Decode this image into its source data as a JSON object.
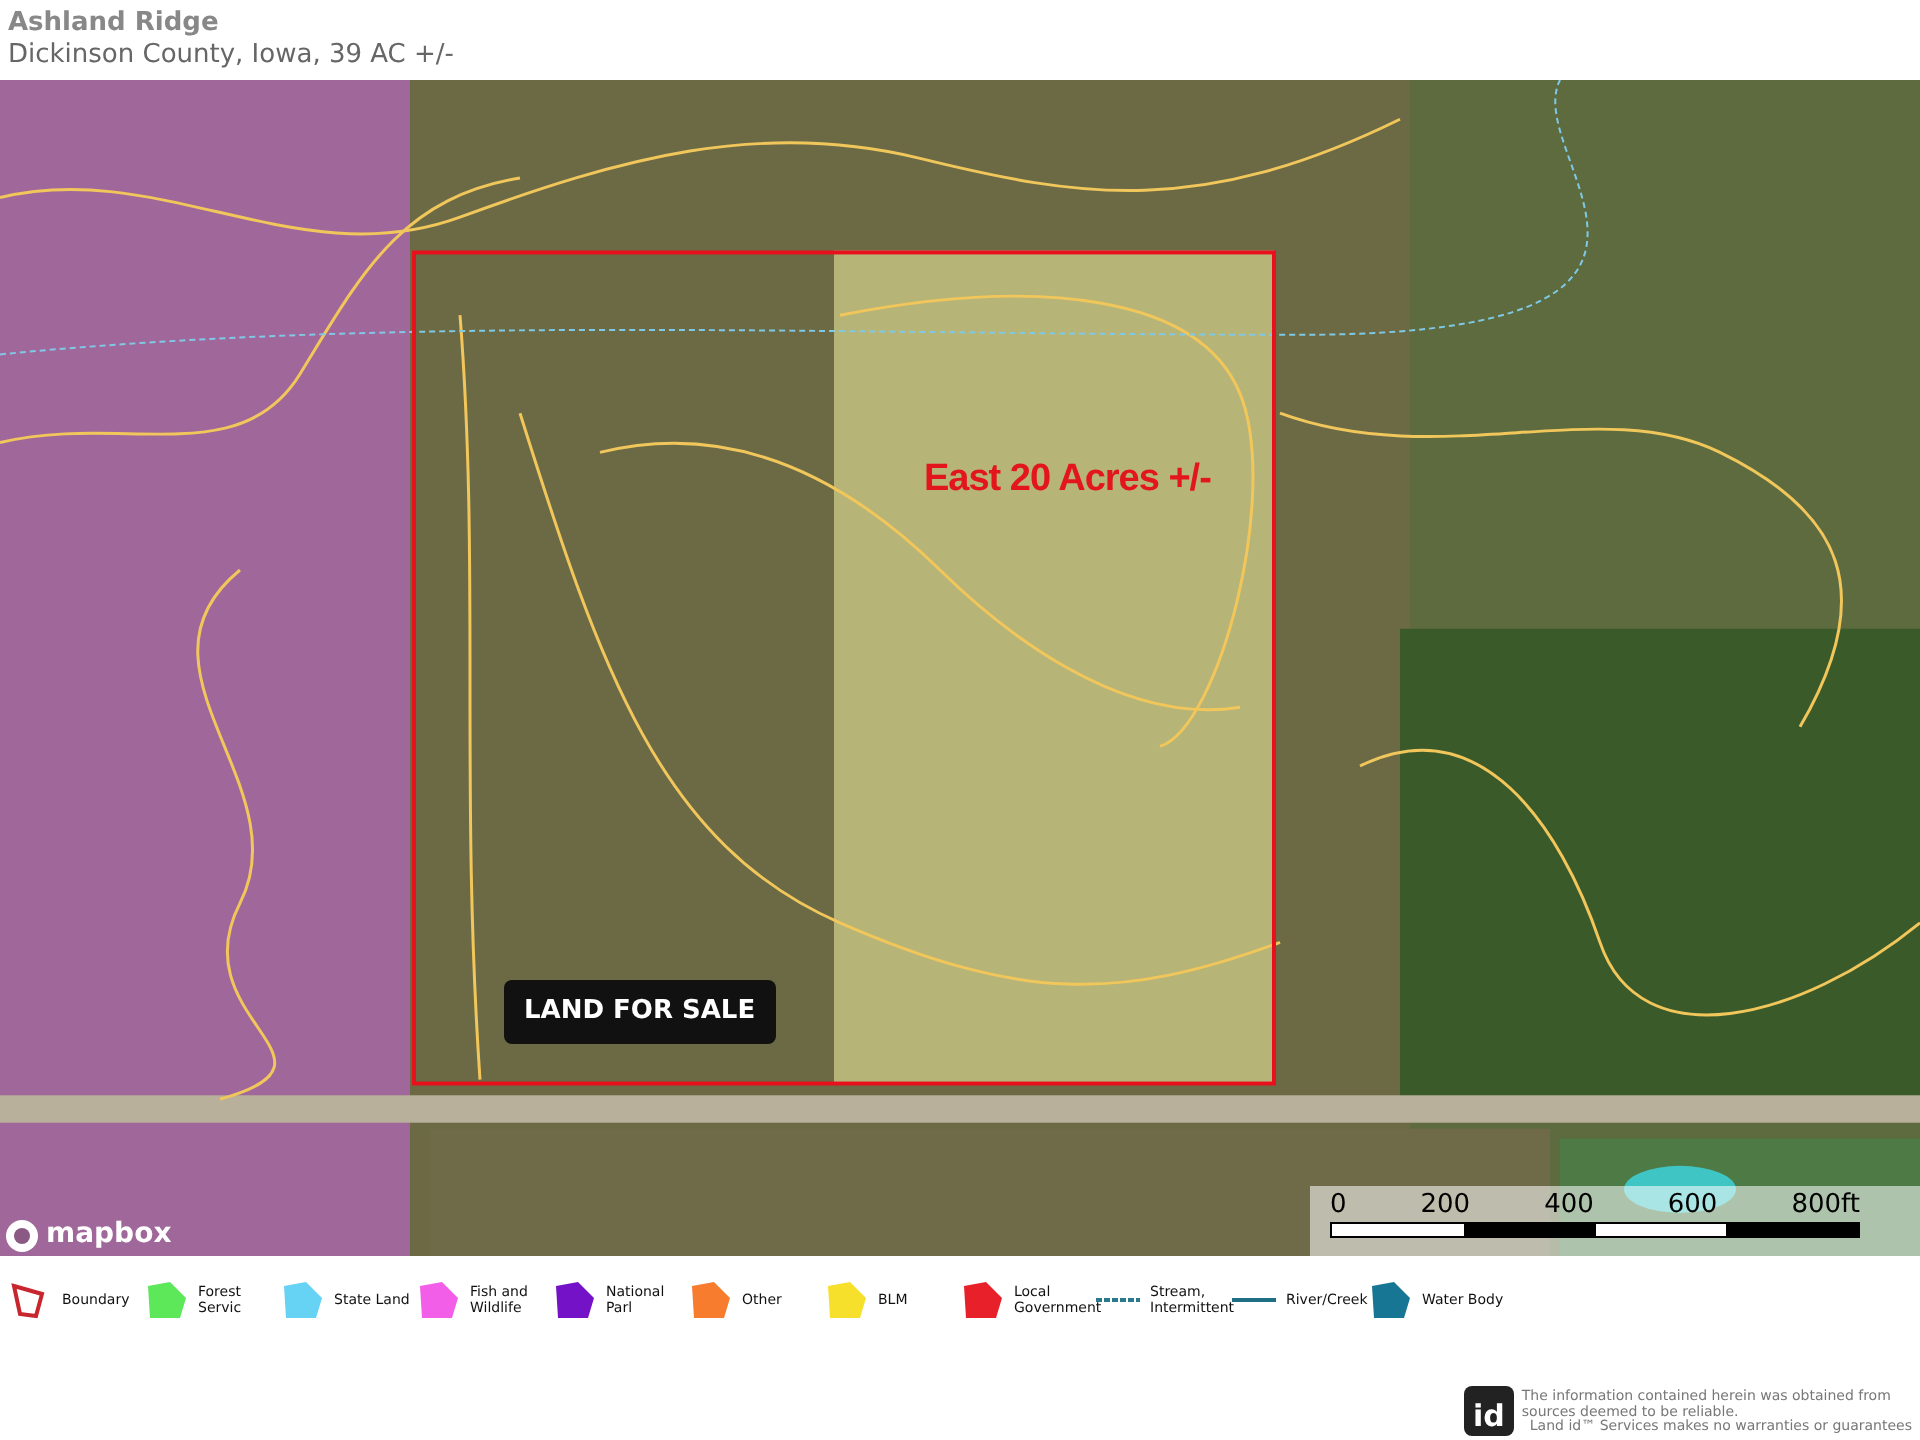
{
  "header": {
    "title": "Ashland Ridge",
    "subtitle": "Dickinson County, Iowa, 39 AC +/-"
  },
  "map": {
    "annotation": "East 20 Acres +/-",
    "badge": "LAND FOR SALE",
    "attribution": "mapbox",
    "scale": {
      "labels": [
        "0",
        "200",
        "400",
        "600",
        "800ft"
      ]
    }
  },
  "legend": [
    {
      "label": "Boundary",
      "kind": "outline",
      "color": "#c8262e"
    },
    {
      "label": "Forest Servic",
      "kind": "polygon",
      "color": "#5de85a"
    },
    {
      "label": "State Land",
      "kind": "polygon",
      "color": "#66d2f4"
    },
    {
      "label": "Fish and Wildlife",
      "kind": "polygon",
      "color": "#f35ee8"
    },
    {
      "label": "National Parl",
      "kind": "polygon",
      "color": "#7412c8"
    },
    {
      "label": "Other",
      "kind": "polygon",
      "color": "#f77c2e"
    },
    {
      "label": "BLM",
      "kind": "polygon",
      "color": "#f6e02c"
    },
    {
      "label": "Local Government",
      "kind": "polygon",
      "color": "#e8202a"
    },
    {
      "label": "Stream, Intermittent",
      "kind": "dashed",
      "color": "#2a7a8c"
    },
    {
      "label": "River/Creek",
      "kind": "line",
      "color": "#1f6f84"
    },
    {
      "label": "Water Body",
      "kind": "polygon",
      "color": "#167694"
    }
  ],
  "footer": {
    "logo": "id",
    "disclaimer": [
      "The information contained herein was obtained from",
      "sources deemed to be reliable.",
      "Land id™ Services makes no warranties or guarantees"
    ]
  }
}
